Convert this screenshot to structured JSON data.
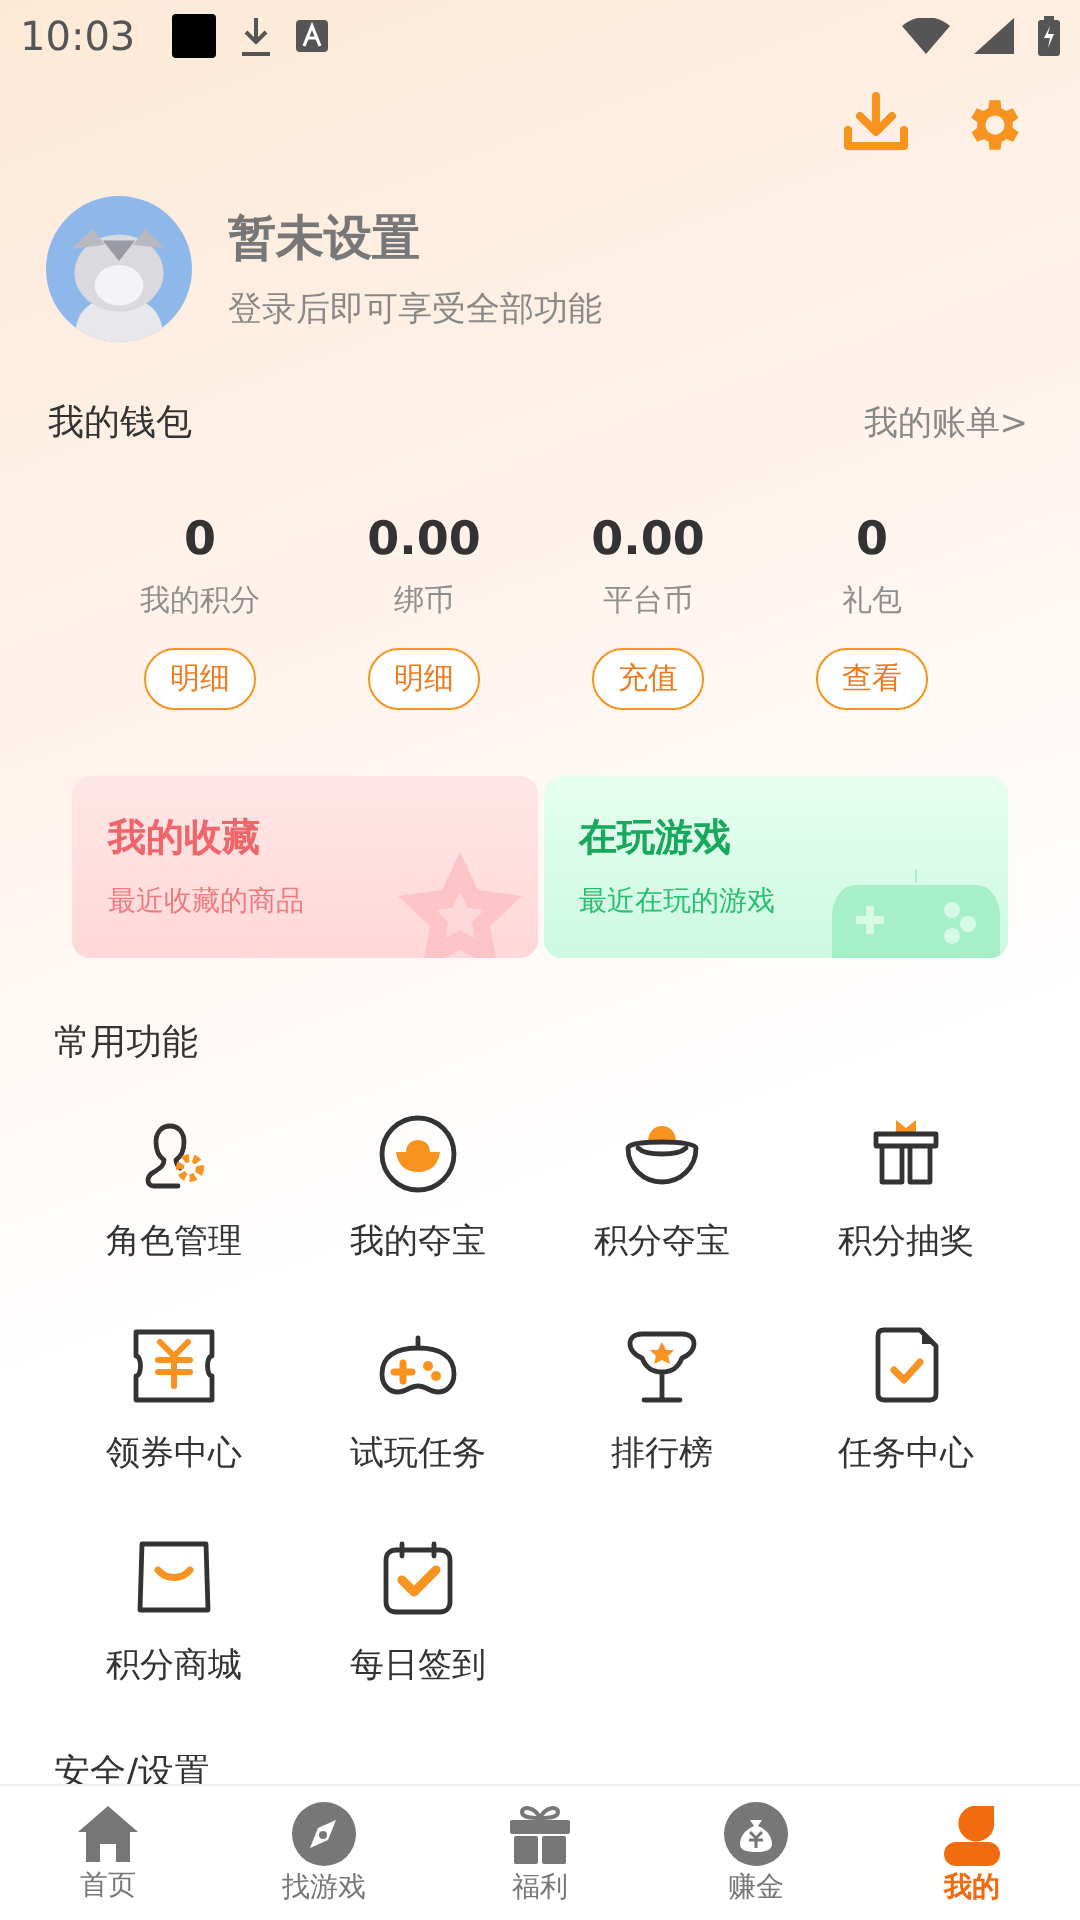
{
  "status_bar": {
    "time": "10:03"
  },
  "profile": {
    "name": "暂未设置",
    "subtitle": "登录后即可享受全部功能"
  },
  "wallet": {
    "title": "我的钱包",
    "link": "我的账单>",
    "stats": [
      {
        "value": "0",
        "label": "我的积分",
        "action": "明细"
      },
      {
        "value": "0.00",
        "label": "绑币",
        "action": "明细"
      },
      {
        "value": "0.00",
        "label": "平台币",
        "action": "充值"
      },
      {
        "value": "0",
        "label": "礼包",
        "action": "查看"
      }
    ]
  },
  "cards": [
    {
      "kind": "favorites",
      "title": "我的收藏",
      "subtitle": "最近收藏的商品"
    },
    {
      "kind": "playing",
      "title": "在玩游戏",
      "subtitle": "最近在玩的游戏"
    }
  ],
  "common_functions": {
    "title": "常用功能",
    "items": [
      "角色管理",
      "我的夺宝",
      "积分夺宝",
      "积分抽奖",
      "领券中心",
      "试玩任务",
      "排行榜",
      "任务中心",
      "积分商城",
      "每日签到"
    ]
  },
  "next_section": {
    "title": "安全/设置"
  },
  "tab_bar": [
    {
      "label": "首页",
      "selected": false
    },
    {
      "label": "找游戏",
      "selected": false
    },
    {
      "label": "福利",
      "selected": false
    },
    {
      "label": "赚金",
      "selected": false
    },
    {
      "label": "我的",
      "selected": true
    }
  ]
}
